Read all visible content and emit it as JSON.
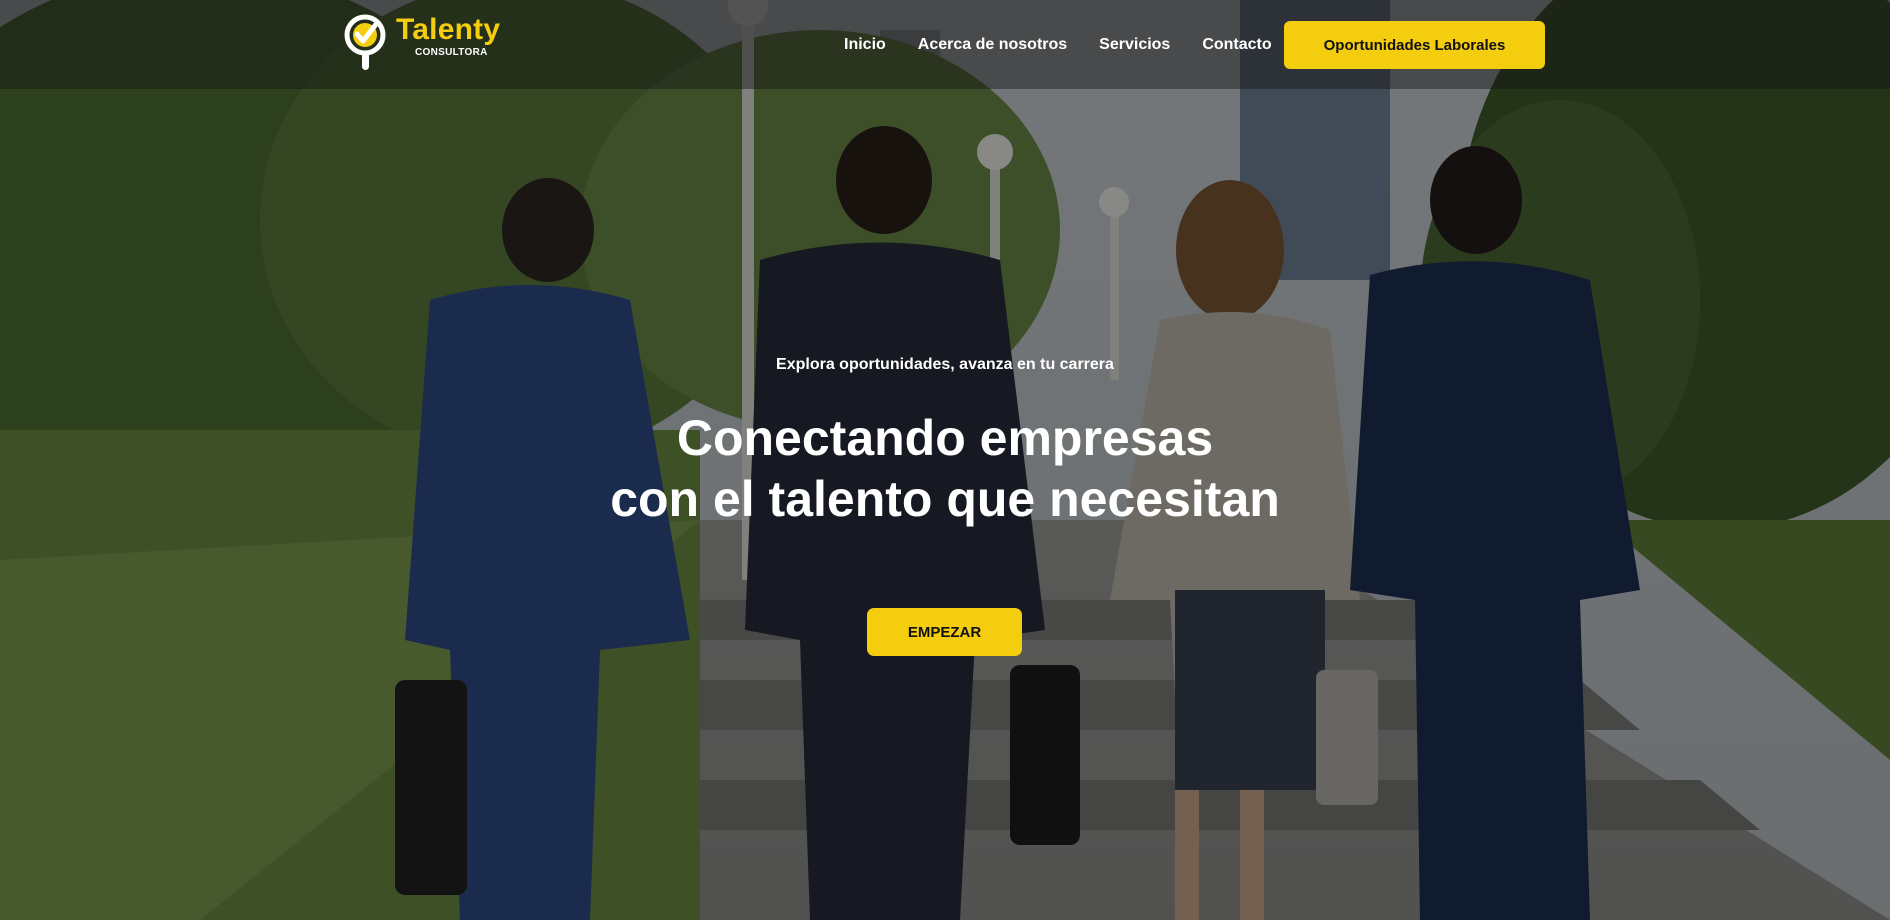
{
  "brand": {
    "name": "Talenty",
    "sub": "CONSULTORA",
    "logo_icon": "magnifier-check-icon",
    "accent_color": "#f4cd0e"
  },
  "nav": {
    "items": [
      {
        "label": "Inicio"
      },
      {
        "label": "Acerca de nosotros"
      },
      {
        "label": "Servicios"
      },
      {
        "label": "Contacto"
      }
    ],
    "cta_label": "Oportunidades Laborales"
  },
  "hero": {
    "tagline": "Explora oportunidades, avanza en tu carrera",
    "headline_line1": "Conectando empresas",
    "headline_line2": "con el talento que necesitan",
    "cta_label": "EMPEZAR",
    "background": "business-people-walking-photo"
  }
}
